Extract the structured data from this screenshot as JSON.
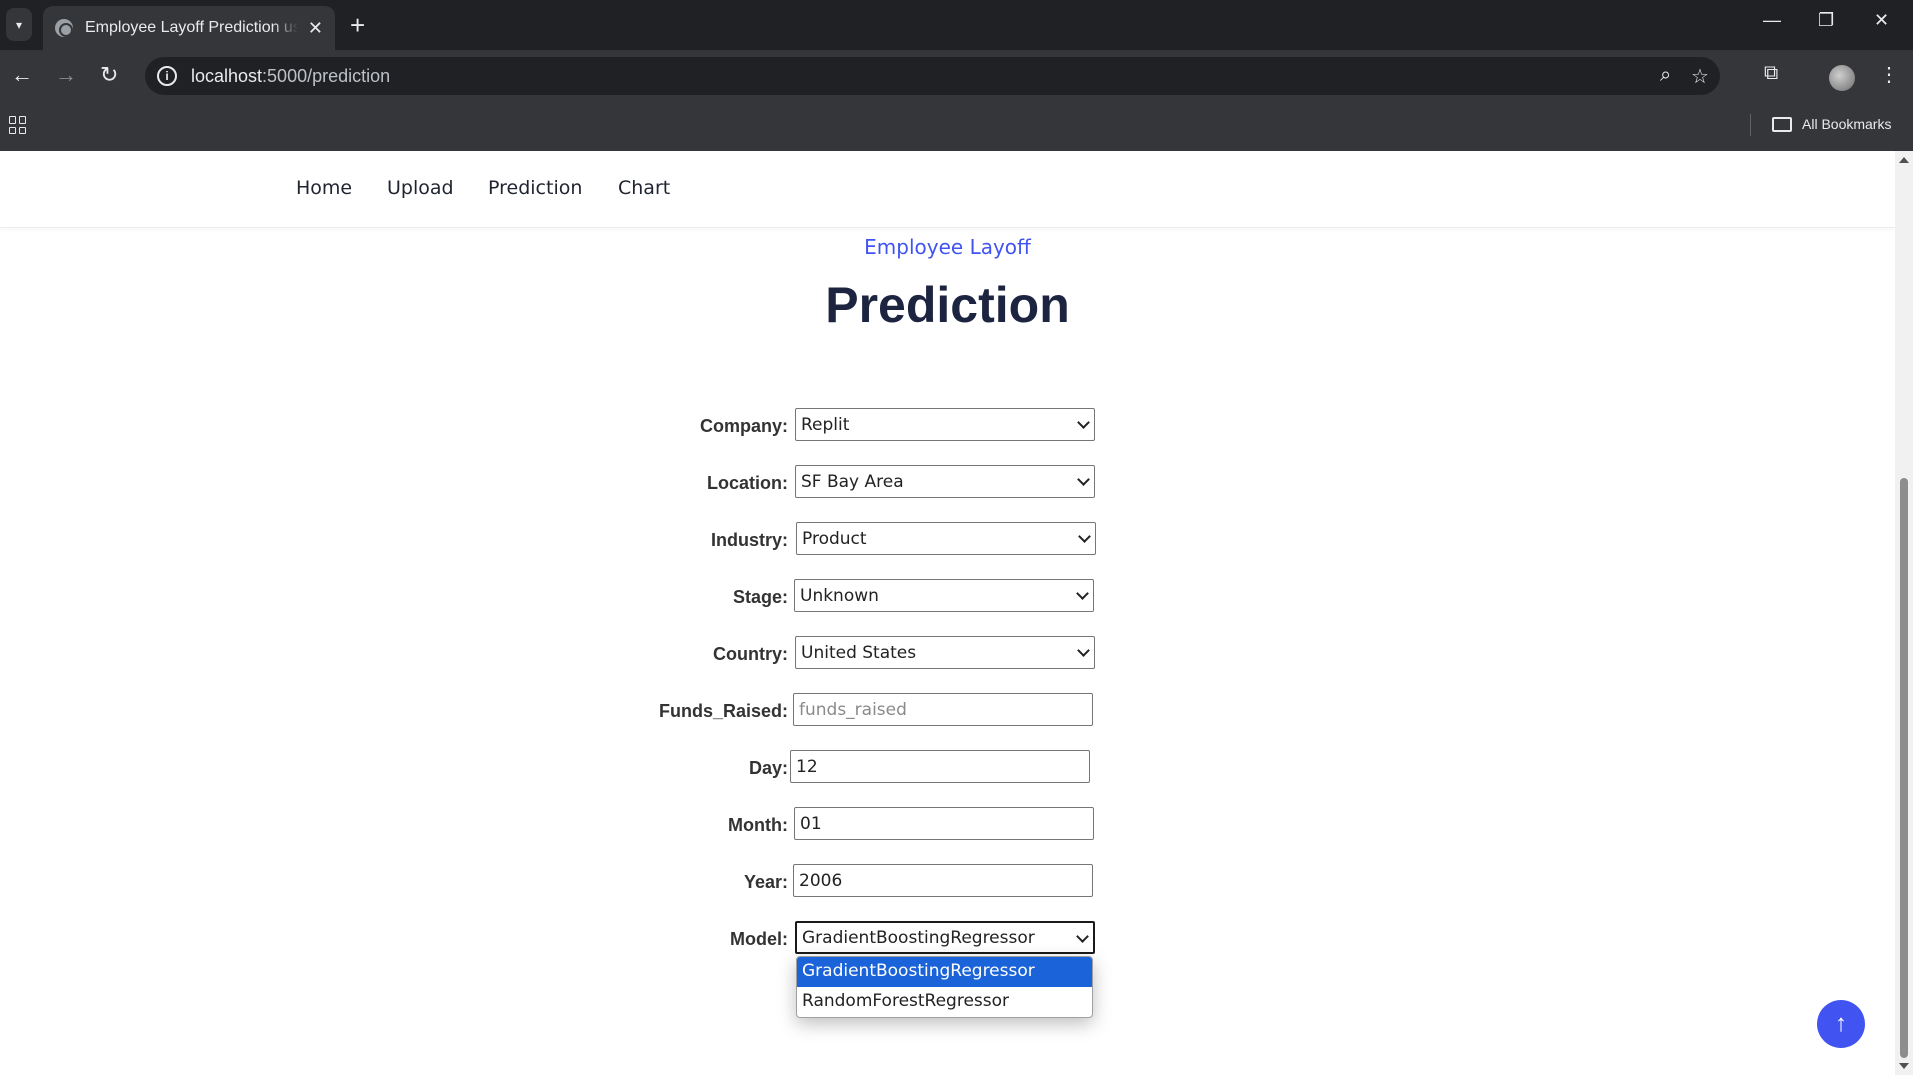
{
  "browser": {
    "tab_title": "Employee Layoff Prediction using",
    "tab_close": "✕",
    "new_tab": "+",
    "url_host": "localhost",
    "url_path": ":5000/prediction",
    "bookmarks_label": "All Bookmarks"
  },
  "nav": {
    "items": [
      "Home",
      "Upload",
      "Prediction",
      "Chart"
    ]
  },
  "hero": {
    "subtitle": "Employee Layoff",
    "title": "Prediction"
  },
  "form": {
    "company": {
      "label": "Company:",
      "value": "Replit"
    },
    "location": {
      "label": "Location:",
      "value": "SF Bay Area"
    },
    "industry": {
      "label": "Industry:",
      "value": "Product"
    },
    "stage": {
      "label": "Stage:",
      "value": "Unknown"
    },
    "country": {
      "label": "Country:",
      "value": "United States"
    },
    "funds_raised": {
      "label": "Funds_Raised:",
      "value": "",
      "placeholder": "funds_raised"
    },
    "day": {
      "label": "Day:",
      "value": "12"
    },
    "month": {
      "label": "Month:",
      "value": "01"
    },
    "year": {
      "label": "Year:",
      "value": "2006"
    },
    "model": {
      "label": "Model:",
      "value": "GradientBoostingRegressor",
      "options": [
        "GradientBoostingRegressor",
        "RandomForestRegressor"
      ]
    }
  },
  "icons": {
    "back_to_top": "arrow-up-icon"
  }
}
